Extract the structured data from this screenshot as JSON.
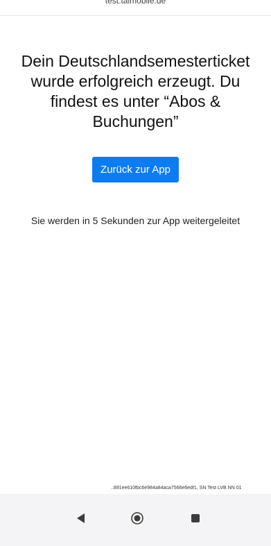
{
  "browser": {
    "url": "test.taimobile.de"
  },
  "main": {
    "headline": "Dein Deutschlandsemesterticket wurde erfolgreich erzeugt. Du findest es unter “Abos & Buchungen”",
    "back_button_label": "Zurück zur App",
    "redirect_message": "Sie werden in 5 Sekunden zur App weitergeleitet"
  },
  "footer": {
    "info": "..891ee610fbc6e984a84aca7566e6edf1, SN Test LVB NN 01"
  },
  "nav": {
    "back_icon": "back-triangle-icon",
    "home_icon": "home-circle-icon",
    "recent_icon": "recent-apps-square-icon"
  },
  "colors": {
    "accent": "#0d7cf2",
    "nav_background": "#f4f4f6"
  }
}
